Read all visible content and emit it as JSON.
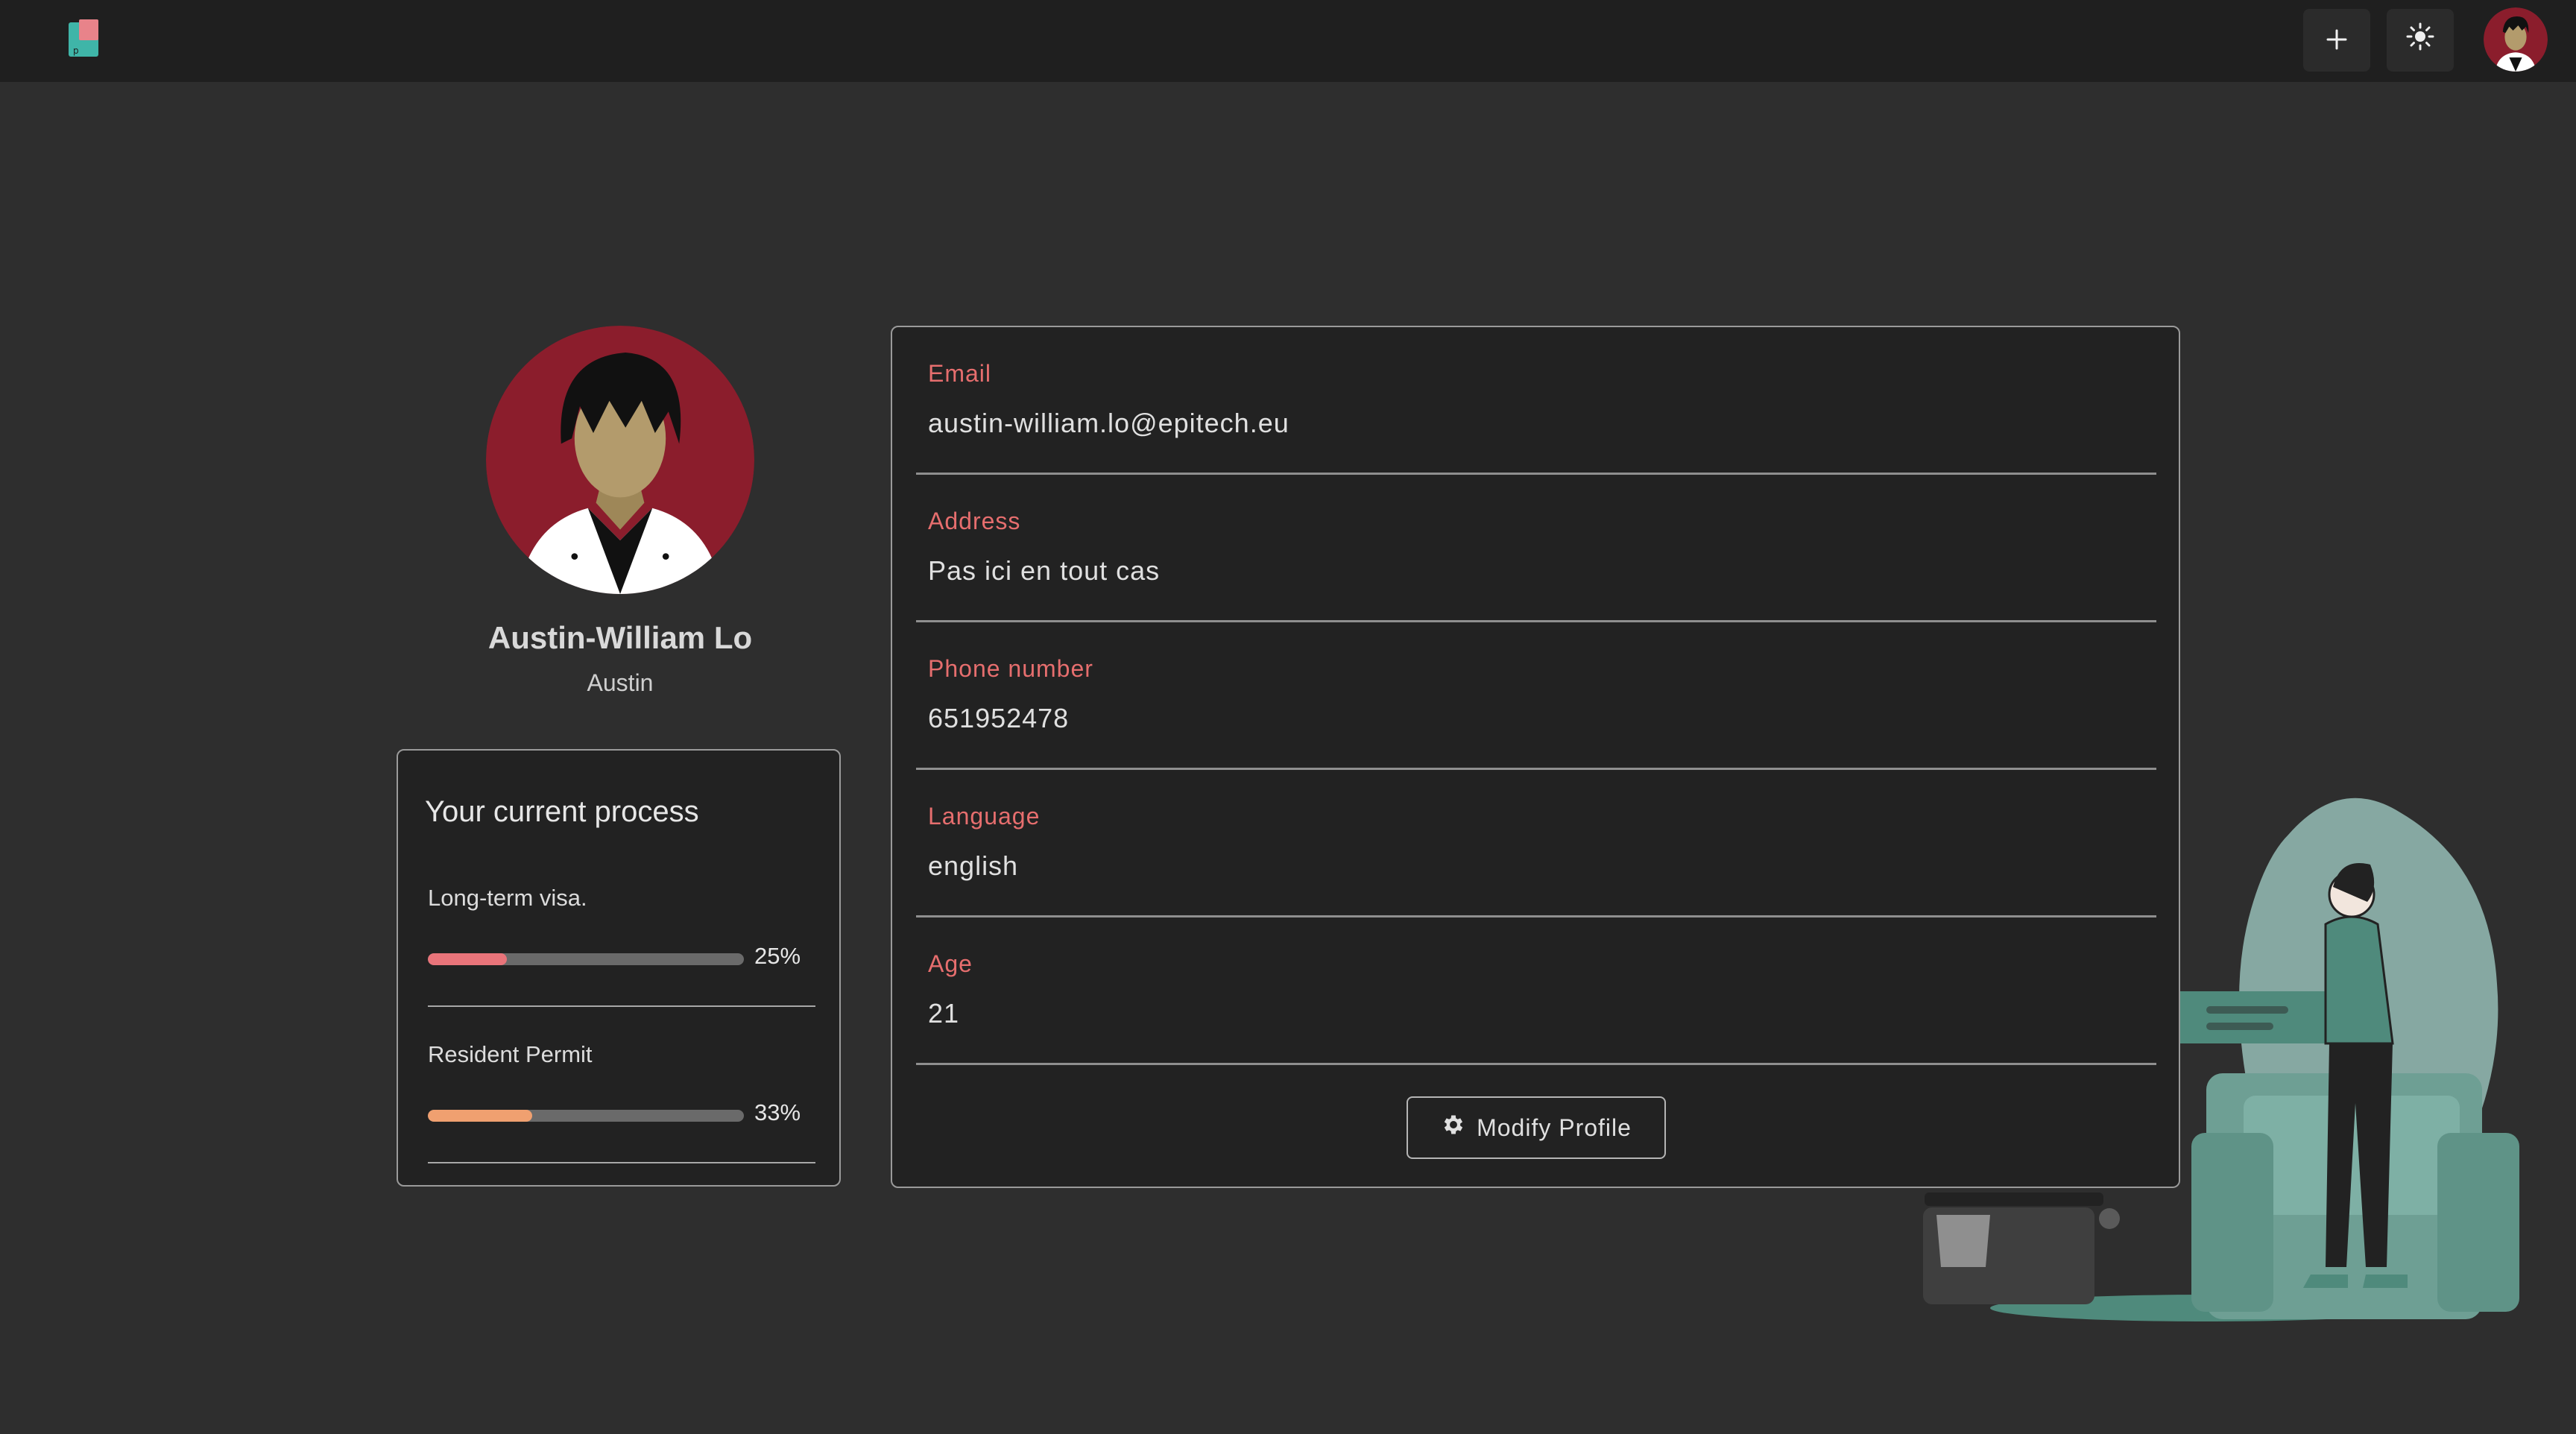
{
  "header": {
    "logo_icon": "app-logo-icon",
    "add_icon": "plus-icon",
    "theme_icon": "sun-icon",
    "avatar_icon": "user-avatar-icon"
  },
  "profile": {
    "name": "Austin-William Lo",
    "nickname": "Austin"
  },
  "process": {
    "title": "Your current process",
    "items": [
      {
        "label": "Long-term visa.",
        "percent_label": "25%",
        "progress": 0.25,
        "color": "#e9747a"
      },
      {
        "label": "Resident Permit",
        "percent_label": "33%",
        "progress": 0.33,
        "color": "#f0a070"
      }
    ]
  },
  "info": {
    "fields": [
      {
        "label": "Email",
        "value": "austin-william.lo@epitech.eu"
      },
      {
        "label": "Address",
        "value": "Pas ici en tout cas"
      },
      {
        "label": "Phone number",
        "value": "651952478"
      },
      {
        "label": "Language",
        "value": "english"
      },
      {
        "label": "Age",
        "value": "21"
      }
    ],
    "modify_button": "Modify Profile",
    "modify_icon": "gear-icon"
  },
  "colors": {
    "accent": "#e66e6e",
    "background": "#2e2e2e",
    "card": "#222222",
    "avatar_bg": "#8b1d2c",
    "illustration_teal": "#4f8a7c"
  }
}
